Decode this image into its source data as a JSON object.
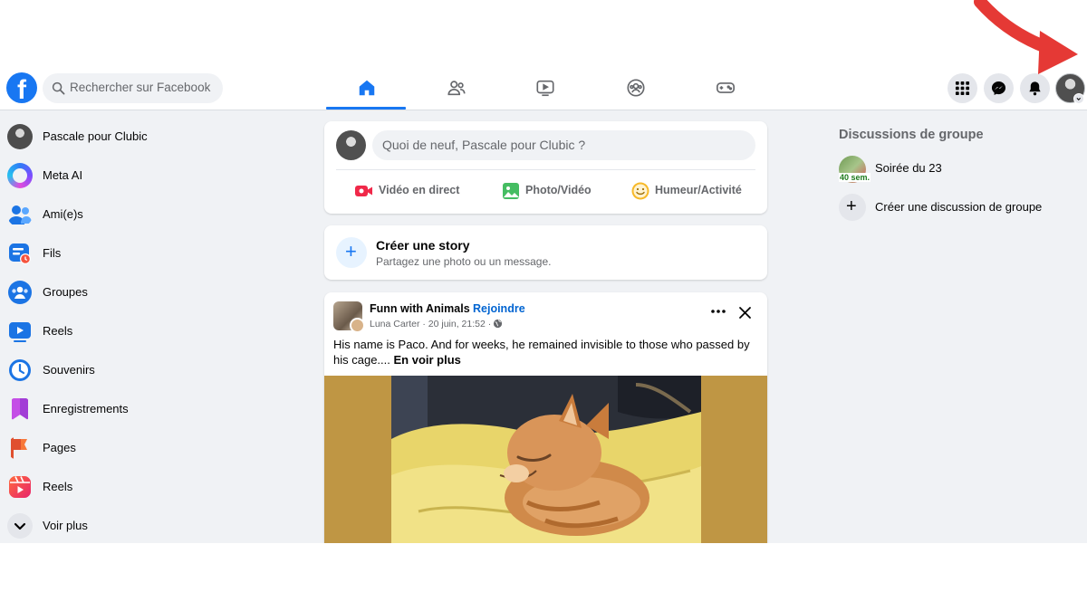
{
  "search": {
    "placeholder": "Rechercher sur Facebook"
  },
  "nav": {
    "tabs": [
      {
        "name": "home",
        "active": true
      },
      {
        "name": "friends",
        "active": false
      },
      {
        "name": "video",
        "active": false
      },
      {
        "name": "groups",
        "active": false
      },
      {
        "name": "gaming",
        "active": false
      }
    ]
  },
  "sidebar": {
    "items": [
      {
        "label": "Pascale pour Clubic",
        "icon": "profile-avatar"
      },
      {
        "label": "Meta AI",
        "icon": "meta-ai-icon"
      },
      {
        "label": "Ami(e)s",
        "icon": "friends-icon"
      },
      {
        "label": "Fils",
        "icon": "feeds-icon"
      },
      {
        "label": "Groupes",
        "icon": "groups-icon"
      },
      {
        "label": "Reels",
        "icon": "video-icon"
      },
      {
        "label": "Souvenirs",
        "icon": "memories-icon"
      },
      {
        "label": "Enregistrements",
        "icon": "saved-icon"
      },
      {
        "label": "Pages",
        "icon": "pages-flag-icon"
      },
      {
        "label": "Reels",
        "icon": "reels-icon"
      },
      {
        "label": "Voir plus",
        "icon": "chevron-down-icon"
      }
    ]
  },
  "composer": {
    "placeholder": "Quoi de neuf, Pascale pour Clubic ?",
    "actions": [
      {
        "label": "Vidéo en direct",
        "icon": "live-video-icon"
      },
      {
        "label": "Photo/Vidéo",
        "icon": "photo-icon"
      },
      {
        "label": "Humeur/Activité",
        "icon": "smiley-icon"
      }
    ]
  },
  "story": {
    "title": "Créer une story",
    "subtitle": "Partagez une photo ou un message."
  },
  "post": {
    "group": "Funn with Animals",
    "separator": "·",
    "join": "Rejoindre",
    "meta": "Luna Carter · 20 juin, 21:52 ·",
    "text": "His name is Paco. And for weeks, he remained invisible to those who passed by his cage....",
    "see_more": "En voir plus"
  },
  "right": {
    "title": "Discussions de groupe",
    "group_name": "Soirée du 23",
    "group_badge": "40 sem.",
    "create_label": "Créer une discussion de groupe",
    "plus": "+"
  },
  "colors": {
    "brand": "#1877f2",
    "arrow": "#e53935"
  }
}
